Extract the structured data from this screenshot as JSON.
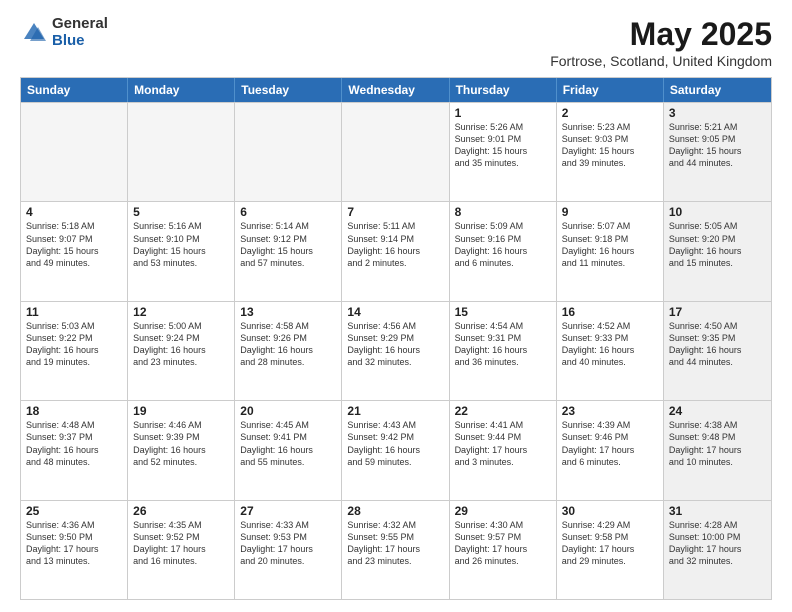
{
  "header": {
    "logo_general": "General",
    "logo_blue": "Blue",
    "title": "May 2025",
    "subtitle": "Fortrose, Scotland, United Kingdom"
  },
  "days": [
    "Sunday",
    "Monday",
    "Tuesday",
    "Wednesday",
    "Thursday",
    "Friday",
    "Saturday"
  ],
  "rows": [
    [
      {
        "num": "",
        "detail": "",
        "empty": true
      },
      {
        "num": "",
        "detail": "",
        "empty": true
      },
      {
        "num": "",
        "detail": "",
        "empty": true
      },
      {
        "num": "",
        "detail": "",
        "empty": true
      },
      {
        "num": "1",
        "detail": "Sunrise: 5:26 AM\nSunset: 9:01 PM\nDaylight: 15 hours\nand 35 minutes."
      },
      {
        "num": "2",
        "detail": "Sunrise: 5:23 AM\nSunset: 9:03 PM\nDaylight: 15 hours\nand 39 minutes."
      },
      {
        "num": "3",
        "detail": "Sunrise: 5:21 AM\nSunset: 9:05 PM\nDaylight: 15 hours\nand 44 minutes.",
        "shaded": true
      }
    ],
    [
      {
        "num": "4",
        "detail": "Sunrise: 5:18 AM\nSunset: 9:07 PM\nDaylight: 15 hours\nand 49 minutes."
      },
      {
        "num": "5",
        "detail": "Sunrise: 5:16 AM\nSunset: 9:10 PM\nDaylight: 15 hours\nand 53 minutes."
      },
      {
        "num": "6",
        "detail": "Sunrise: 5:14 AM\nSunset: 9:12 PM\nDaylight: 15 hours\nand 57 minutes."
      },
      {
        "num": "7",
        "detail": "Sunrise: 5:11 AM\nSunset: 9:14 PM\nDaylight: 16 hours\nand 2 minutes."
      },
      {
        "num": "8",
        "detail": "Sunrise: 5:09 AM\nSunset: 9:16 PM\nDaylight: 16 hours\nand 6 minutes."
      },
      {
        "num": "9",
        "detail": "Sunrise: 5:07 AM\nSunset: 9:18 PM\nDaylight: 16 hours\nand 11 minutes."
      },
      {
        "num": "10",
        "detail": "Sunrise: 5:05 AM\nSunset: 9:20 PM\nDaylight: 16 hours\nand 15 minutes.",
        "shaded": true
      }
    ],
    [
      {
        "num": "11",
        "detail": "Sunrise: 5:03 AM\nSunset: 9:22 PM\nDaylight: 16 hours\nand 19 minutes."
      },
      {
        "num": "12",
        "detail": "Sunrise: 5:00 AM\nSunset: 9:24 PM\nDaylight: 16 hours\nand 23 minutes."
      },
      {
        "num": "13",
        "detail": "Sunrise: 4:58 AM\nSunset: 9:26 PM\nDaylight: 16 hours\nand 28 minutes."
      },
      {
        "num": "14",
        "detail": "Sunrise: 4:56 AM\nSunset: 9:29 PM\nDaylight: 16 hours\nand 32 minutes."
      },
      {
        "num": "15",
        "detail": "Sunrise: 4:54 AM\nSunset: 9:31 PM\nDaylight: 16 hours\nand 36 minutes."
      },
      {
        "num": "16",
        "detail": "Sunrise: 4:52 AM\nSunset: 9:33 PM\nDaylight: 16 hours\nand 40 minutes."
      },
      {
        "num": "17",
        "detail": "Sunrise: 4:50 AM\nSunset: 9:35 PM\nDaylight: 16 hours\nand 44 minutes.",
        "shaded": true
      }
    ],
    [
      {
        "num": "18",
        "detail": "Sunrise: 4:48 AM\nSunset: 9:37 PM\nDaylight: 16 hours\nand 48 minutes."
      },
      {
        "num": "19",
        "detail": "Sunrise: 4:46 AM\nSunset: 9:39 PM\nDaylight: 16 hours\nand 52 minutes."
      },
      {
        "num": "20",
        "detail": "Sunrise: 4:45 AM\nSunset: 9:41 PM\nDaylight: 16 hours\nand 55 minutes."
      },
      {
        "num": "21",
        "detail": "Sunrise: 4:43 AM\nSunset: 9:42 PM\nDaylight: 16 hours\nand 59 minutes."
      },
      {
        "num": "22",
        "detail": "Sunrise: 4:41 AM\nSunset: 9:44 PM\nDaylight: 17 hours\nand 3 minutes."
      },
      {
        "num": "23",
        "detail": "Sunrise: 4:39 AM\nSunset: 9:46 PM\nDaylight: 17 hours\nand 6 minutes."
      },
      {
        "num": "24",
        "detail": "Sunrise: 4:38 AM\nSunset: 9:48 PM\nDaylight: 17 hours\nand 10 minutes.",
        "shaded": true
      }
    ],
    [
      {
        "num": "25",
        "detail": "Sunrise: 4:36 AM\nSunset: 9:50 PM\nDaylight: 17 hours\nand 13 minutes."
      },
      {
        "num": "26",
        "detail": "Sunrise: 4:35 AM\nSunset: 9:52 PM\nDaylight: 17 hours\nand 16 minutes."
      },
      {
        "num": "27",
        "detail": "Sunrise: 4:33 AM\nSunset: 9:53 PM\nDaylight: 17 hours\nand 20 minutes."
      },
      {
        "num": "28",
        "detail": "Sunrise: 4:32 AM\nSunset: 9:55 PM\nDaylight: 17 hours\nand 23 minutes."
      },
      {
        "num": "29",
        "detail": "Sunrise: 4:30 AM\nSunset: 9:57 PM\nDaylight: 17 hours\nand 26 minutes."
      },
      {
        "num": "30",
        "detail": "Sunrise: 4:29 AM\nSunset: 9:58 PM\nDaylight: 17 hours\nand 29 minutes."
      },
      {
        "num": "31",
        "detail": "Sunrise: 4:28 AM\nSunset: 10:00 PM\nDaylight: 17 hours\nand 32 minutes.",
        "shaded": true
      }
    ]
  ]
}
